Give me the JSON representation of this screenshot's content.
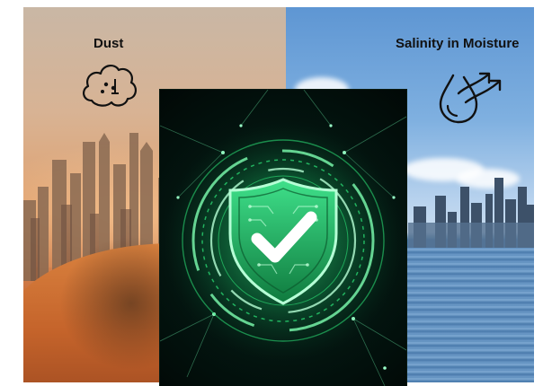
{
  "labels": {
    "left": "Dust",
    "right": "Salinity in Moisture"
  },
  "icons": {
    "left": "dust-cloud-icon",
    "right": "water-drop-wind-icon",
    "center": "shield-check-icon"
  },
  "colors": {
    "accent": "#2ee87a",
    "glow": "#7dffb0",
    "center_bg": "#03140f",
    "text": "#111111"
  }
}
